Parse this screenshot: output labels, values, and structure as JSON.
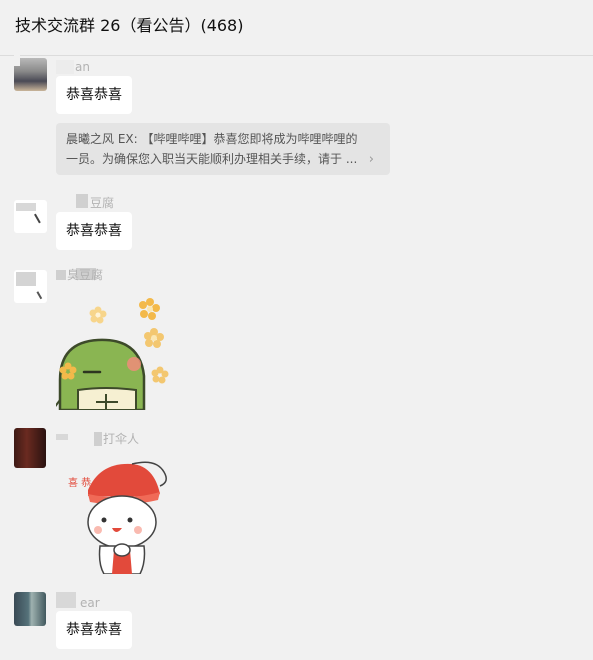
{
  "header": {
    "title": "技术交流群 26（看公告）(468)"
  },
  "messages": [
    {
      "sender": "an",
      "text": "恭喜恭喜"
    },
    {
      "quote_line1": "晨曦之风 EX: 【哔哩哔哩】恭喜您即将成为哔哩哔哩的",
      "quote_line2": "一员。为确保您入职当天能顺利办理相关手续，请于 ...",
      "chevron": "›"
    },
    {
      "sender": "豆腐",
      "text": "恭喜恭喜"
    },
    {
      "sender": "臭豆腐",
      "sticker": "turtle-sticker"
    },
    {
      "sender": "打伞人",
      "sticker": "congrats-sticker",
      "sticker_text": "喜 恭"
    },
    {
      "sender": "ear",
      "text": "恭喜恭喜"
    }
  ],
  "colors": {
    "background": "#f1f1f1",
    "bubble": "#ffffff",
    "quote_bg": "#e4e4e4",
    "turtle_green": "#8ab552",
    "sticker_red": "#e24a3b",
    "flower_yellow": "#f3b94a"
  }
}
